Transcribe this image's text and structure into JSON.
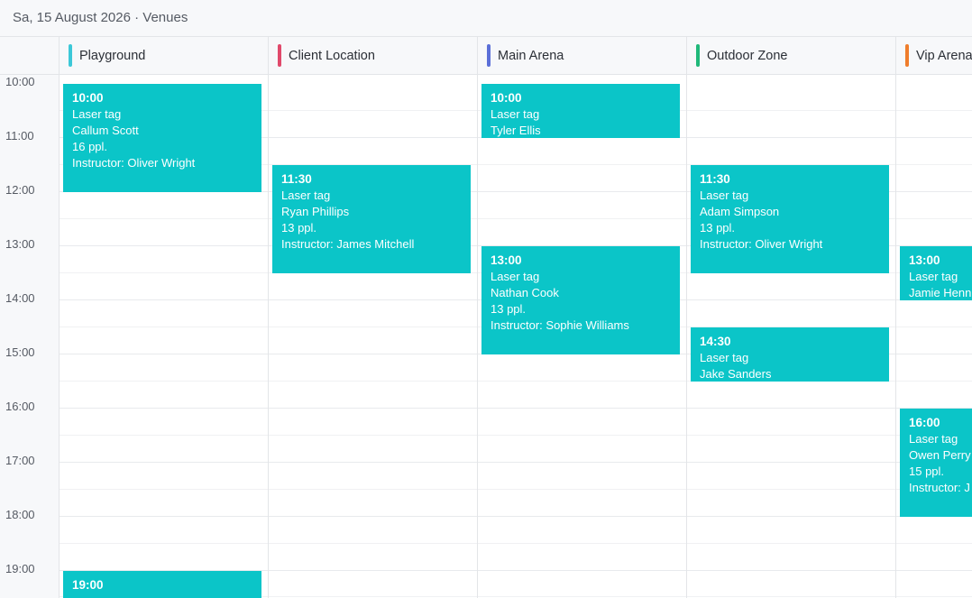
{
  "header": {
    "title": "Sa, 15 August 2026 · Venues"
  },
  "venues": [
    {
      "name": "Playground",
      "color": "#3cc8d8"
    },
    {
      "name": "Client Location",
      "color": "#e0496b"
    },
    {
      "name": "Main Arena",
      "color": "#5b6fd8"
    },
    {
      "name": "Outdoor Zone",
      "color": "#20b87a"
    },
    {
      "name": "Vip Arena",
      "color": "#ef7d2c"
    }
  ],
  "times": [
    "10:00",
    "11:00",
    "12:00",
    "13:00",
    "14:00",
    "15:00",
    "16:00",
    "17:00",
    "18:00",
    "19:00"
  ],
  "events": [
    {
      "time": "10:00",
      "activity": "Laser tag",
      "client": "Callum Scott",
      "people": "16 ppl.",
      "instructor": "Instructor: Oliver Wright"
    },
    {
      "time": "19:00"
    },
    {
      "time": "11:30",
      "activity": "Laser tag",
      "client": "Ryan Phillips",
      "people": "13 ppl.",
      "instructor": "Instructor: James Mitchell"
    },
    {
      "time": "10:00",
      "activity": "Laser tag",
      "client": "Tyler Ellis"
    },
    {
      "time": "13:00",
      "activity": "Laser tag",
      "client": "Nathan Cook",
      "people": "13 ppl.",
      "instructor": "Instructor: Sophie Williams"
    },
    {
      "time": "11:30",
      "activity": "Laser tag",
      "client": "Adam Simpson",
      "people": "13 ppl.",
      "instructor": "Instructor: Oliver Wright"
    },
    {
      "time": "14:30",
      "activity": "Laser tag",
      "client": "Jake Sanders"
    },
    {
      "time": "13:00",
      "activity": "Laser tag",
      "client": "Jamie Henn"
    },
    {
      "time": "16:00",
      "activity": "Laser tag",
      "client": "Owen Perry",
      "people": "15 ppl.",
      "instructor": "Instructor: J"
    }
  ]
}
